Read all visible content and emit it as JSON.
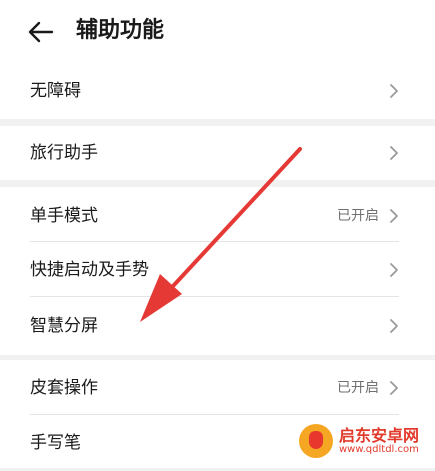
{
  "header": {
    "title": "辅助功能",
    "back_icon": "arrow-left-icon"
  },
  "groups": [
    {
      "items": [
        {
          "label": "无障碍",
          "status": ""
        }
      ]
    },
    {
      "items": [
        {
          "label": "旅行助手",
          "status": ""
        }
      ]
    },
    {
      "items": [
        {
          "label": "单手模式",
          "status": "已开启"
        },
        {
          "label": "快捷启动及手势",
          "status": ""
        },
        {
          "label": "智慧分屏",
          "status": ""
        }
      ]
    },
    {
      "items": [
        {
          "label": "皮套操作",
          "status": "已开启"
        },
        {
          "label": "手写笔",
          "status": ""
        }
      ]
    }
  ],
  "annotation": {
    "color": "#e53935",
    "points_to": "智慧分屏"
  },
  "watermark": {
    "title": "启东安卓网",
    "url": "www.qdltdl.com"
  },
  "colors": {
    "page_bg": "#f1f1f1",
    "card_bg": "#ffffff",
    "chevron": "#9a9a9a",
    "status_text": "#6f6f6f"
  }
}
